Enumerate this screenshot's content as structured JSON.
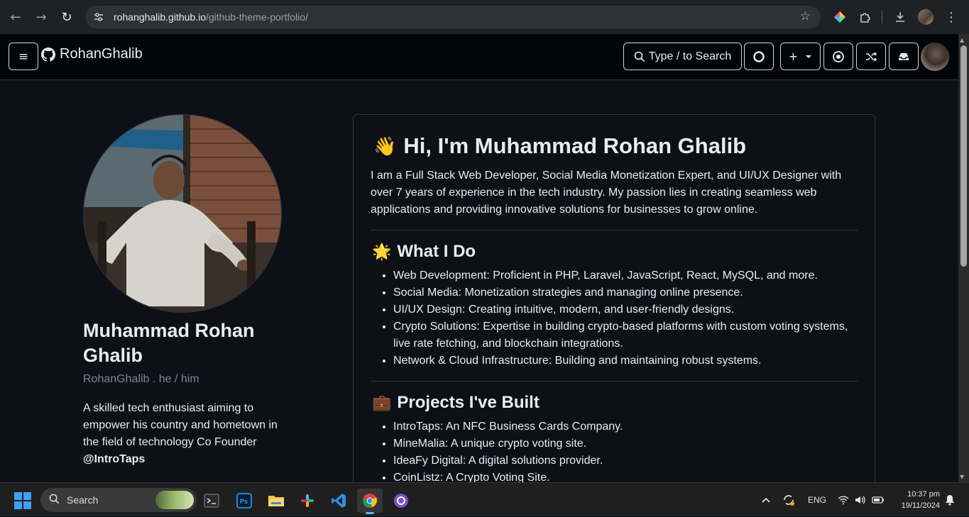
{
  "browser": {
    "url_host": "rohanghalib.github.io",
    "url_path": "/github-theme-portfolio/"
  },
  "header": {
    "brand": "RohanGhalib",
    "search_label": "Type / to Search",
    "new_label": "+"
  },
  "profile": {
    "name": "Muhammad Rohan Ghalib",
    "handle": "RohanGhalib . he / him",
    "bio": "A skilled tech enthusiast aiming to empower his country and hometown in the field of technology Co Founder",
    "company": "@IntroTaps"
  },
  "readme": {
    "heading_emoji": "👋",
    "heading": "Hi, I'm Muhammad Rohan Ghalib",
    "intro": "I am a Full Stack Web Developer, Social Media Monetization Expert, and UI/UX Designer with over 7 years of experience in the tech industry. My passion lies in creating seamless web applications and providing innovative solutions for businesses to grow online.",
    "what_emoji": "🌟",
    "what_heading": "What I Do",
    "what_items": [
      "Web Development: Proficient in PHP, Laravel, JavaScript, React, MySQL, and more.",
      "Social Media: Monetization strategies and managing online presence.",
      "UI/UX Design: Creating intuitive, modern, and user-friendly designs.",
      "Crypto Solutions: Expertise in building crypto-based platforms with custom voting systems, live rate fetching, and blockchain integrations.",
      "Network & Cloud Infrastructure: Building and maintaining robust systems."
    ],
    "projects_emoji": "💼",
    "projects_heading": "Projects I've Built",
    "project_items": [
      "IntroTaps: An NFC Business Cards Company.",
      "MineMalia: A unique crypto voting site.",
      "IdeaFy Digital: A digital solutions provider.",
      "CoinListz: A Crypto Voting Site."
    ]
  },
  "taskbar": {
    "search_label": "Search",
    "language": "ENG",
    "time": "10:37 pm",
    "date": "19/11/2024"
  },
  "colors": {
    "page_bg": "#0d1117",
    "header_bg": "#010409",
    "border": "#30363d",
    "muted_text": "#7d8590",
    "text": "#e6edf3"
  }
}
